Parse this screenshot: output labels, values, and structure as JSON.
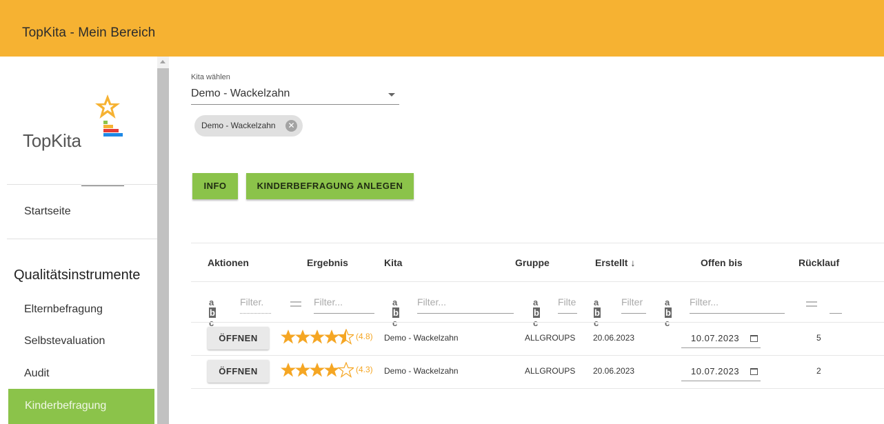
{
  "app": {
    "title": "TopKita - Mein Bereich"
  },
  "sidebar": {
    "logo_text": "TopKita",
    "start": "Startseite",
    "section": "Qualitätsinstrumente",
    "items": [
      "Elternbefragung",
      "Selbstevaluation",
      "Audit",
      "Kinderbefragung"
    ],
    "active": "Kinderbefragung"
  },
  "kita_select": {
    "label": "Kita wählen",
    "value": "Demo - Wackelzahn",
    "chip": "Demo - Wackelzahn"
  },
  "buttons": {
    "info": "INFO",
    "create": "KINDERBEFRAGUNG ANLEGEN"
  },
  "table": {
    "headers": [
      "Aktionen",
      "Ergebnis",
      "Kita",
      "Gruppe",
      "Erstellt",
      "Offen bis",
      "Rücklauf"
    ],
    "sort_indicator": "↓",
    "filter_placeholders": {
      "aktionen": "Filter.",
      "ergebnis": "Filter...",
      "kita": "Filter...",
      "gruppe": "Filte",
      "erstellt": "Filter",
      "offen_bis": "Filter..."
    },
    "abc_icon_text": {
      "a": "a",
      "b": "b",
      "c": "c"
    },
    "rows": [
      {
        "action": "ÖFFNEN",
        "rating": 4.5,
        "score": "(4.8)",
        "kita": "Demo - Wackelzahn",
        "gruppe": "ALLGROUPS",
        "erstellt": "20.06.2023",
        "offen_bis": "10.07.2023",
        "ruecklauf": "5"
      },
      {
        "action": "ÖFFNEN",
        "rating": 4,
        "score": "(4.3)",
        "kita": "Demo - Wackelzahn",
        "gruppe": "ALLGROUPS",
        "erstellt": "20.06.2023",
        "offen_bis": "10.07.2023",
        "ruecklauf": "2"
      }
    ]
  },
  "colors": {
    "topbar": "#f6b232",
    "accent_green": "#8bc34a",
    "star": "#f5a623"
  }
}
